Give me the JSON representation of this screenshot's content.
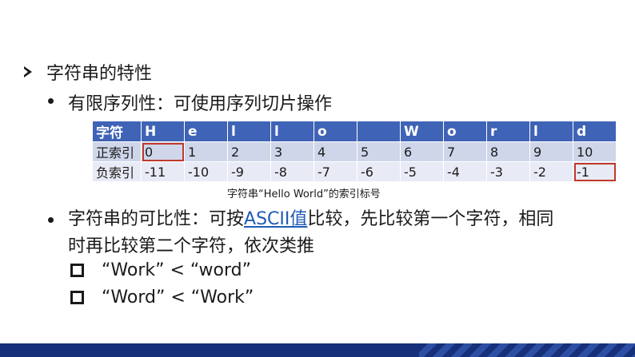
{
  "heading": "字符串的特性",
  "bullet1": "有限序列性：可使用序列切片操作",
  "table": {
    "header": [
      "字符",
      "H",
      "e",
      "l",
      "l",
      "o",
      "",
      "W",
      "o",
      "r",
      "l",
      "d"
    ],
    "positive": [
      "正索引",
      "0",
      "1",
      "2",
      "3",
      "4",
      "5",
      "6",
      "7",
      "8",
      "9",
      "10"
    ],
    "negative": [
      "负索引",
      "-11",
      "-10",
      "-9",
      "-8",
      "-7",
      "-6",
      "-5",
      "-4",
      "-3",
      "-2",
      "-1"
    ]
  },
  "caption": "字符串“Hello World”的索引标号",
  "bullet2": {
    "before": "字符串的可比性：可按",
    "link": "ASCII值",
    "after": "比较，先比较第一个字符，相同",
    "line2": "时再比较第二个字符，依次类推"
  },
  "compare": [
    "“Work” < “word”",
    "“Word” < “Work”"
  ],
  "colors": {
    "header_bg": "#3f63b6",
    "row_pos_bg": "#cfd6ea",
    "row_neg_bg": "#e8ebf5",
    "highlight": "#c0392b",
    "footer": "#17307a",
    "link": "#1f5bb5"
  }
}
